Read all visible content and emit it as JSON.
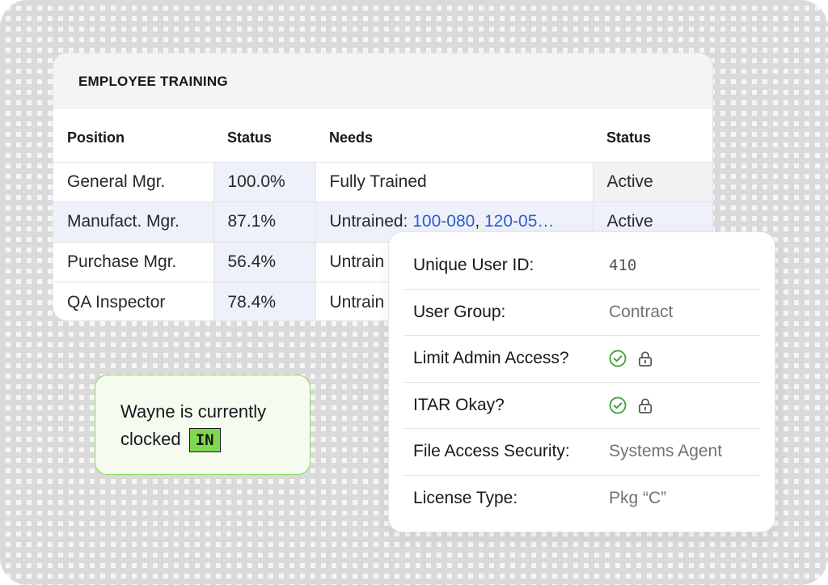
{
  "training": {
    "title": "EMPLOYEE TRAINING",
    "columns": [
      "Position",
      "Status",
      "Needs",
      "Status"
    ],
    "rows": [
      {
        "position": "General Mgr.",
        "pct": "100.0%",
        "needs_prefix": "Fully Trained",
        "needs_link1": "",
        "needs_sep": "",
        "needs_link2": "",
        "status": "Active"
      },
      {
        "position": "Manufact. Mgr.",
        "pct": "87.1%",
        "needs_prefix": "Untrained: ",
        "needs_link1": "100-080",
        "needs_sep": ", ",
        "needs_link2": "120-05…",
        "status": "Active"
      },
      {
        "position": "Purchase Mgr.",
        "pct": "56.4%",
        "needs_prefix": "Untrain",
        "needs_link1": "",
        "needs_sep": "",
        "needs_link2": "",
        "status": ""
      },
      {
        "position": "QA Inspector",
        "pct": "78.4%",
        "needs_prefix": "Untrain",
        "needs_link1": "",
        "needs_sep": "",
        "needs_link2": "",
        "status": ""
      }
    ]
  },
  "clock": {
    "line1": "Wayne is currently",
    "line2": "clocked",
    "badge": "IN"
  },
  "user": {
    "rows": [
      {
        "label": "Unique User ID:",
        "value": "410"
      },
      {
        "label": "User Group:",
        "value": "Contract"
      },
      {
        "label": "Limit Admin Access?",
        "icons": [
          "check-circle-icon",
          "lock-icon"
        ]
      },
      {
        "label": "ITAR Okay?",
        "icons": [
          "check-circle-icon",
          "lock-icon"
        ]
      },
      {
        "label": "File Access Security:",
        "value": "Systems Agent"
      },
      {
        "label": "License Type:",
        "value": "Pkg “C”"
      }
    ]
  },
  "colors": {
    "accent_blue": "#2c5bd6",
    "alert_orange": "#f0551f",
    "success_green": "#7fd94f"
  }
}
